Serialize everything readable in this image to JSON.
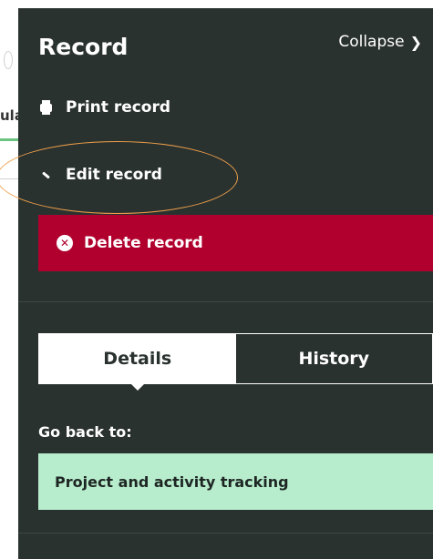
{
  "background": {
    "partial_text": "ula"
  },
  "panel": {
    "title": "Record",
    "collapse_label": "Collapse",
    "actions": {
      "print_label": "Print record",
      "edit_label": "Edit record",
      "delete_label": "Delete record"
    },
    "tabs": [
      {
        "label": "Details",
        "active": true
      },
      {
        "label": "History",
        "active": false
      }
    ],
    "go_back": {
      "label": "Go back to:",
      "link_text": "Project and activity tracking"
    }
  },
  "icons": {
    "print": "printer-icon",
    "edit": "pencil-icon",
    "delete": "x-circle-icon",
    "collapse": "chevron-right-icon"
  },
  "colors": {
    "panel_bg": "#2a3230",
    "delete_bg": "#b1002e",
    "goback_bg": "#b7edcc",
    "highlight_ring": "#f0a04a",
    "accent_green": "#6cc27f"
  }
}
